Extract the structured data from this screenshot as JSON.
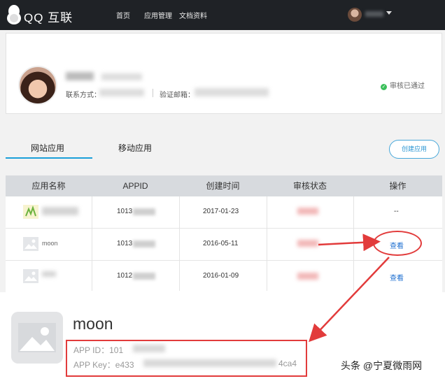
{
  "header": {
    "brand": "QQ 互联",
    "nav": [
      "首页",
      "应用管理",
      "文档资料"
    ]
  },
  "profile": {
    "contact_label": "联系方式：",
    "email_label": "验证邮箱：",
    "status": "审核已通过"
  },
  "tabs": [
    "网站应用",
    "移动应用"
  ],
  "create_button": "创建应用",
  "table": {
    "headers": [
      "应用名称",
      "APPID",
      "创建时间",
      "审核状态",
      "操作"
    ],
    "rows": [
      {
        "appid_prefix": "1013",
        "created": "2017-01-23",
        "action": "--"
      },
      {
        "name_visible": "moon",
        "appid_prefix": "1013",
        "created": "2016-05-11",
        "action": "查看"
      },
      {
        "appid_prefix": "1012",
        "created": "2016-01-09",
        "action": "查看"
      }
    ]
  },
  "detail": {
    "app_name": "moon",
    "app_id_label": "APP ID：101",
    "app_key_label": "APP Key：e433",
    "app_key_tail": "4ca4"
  },
  "watermark": "头条 @宁夏微雨网"
}
